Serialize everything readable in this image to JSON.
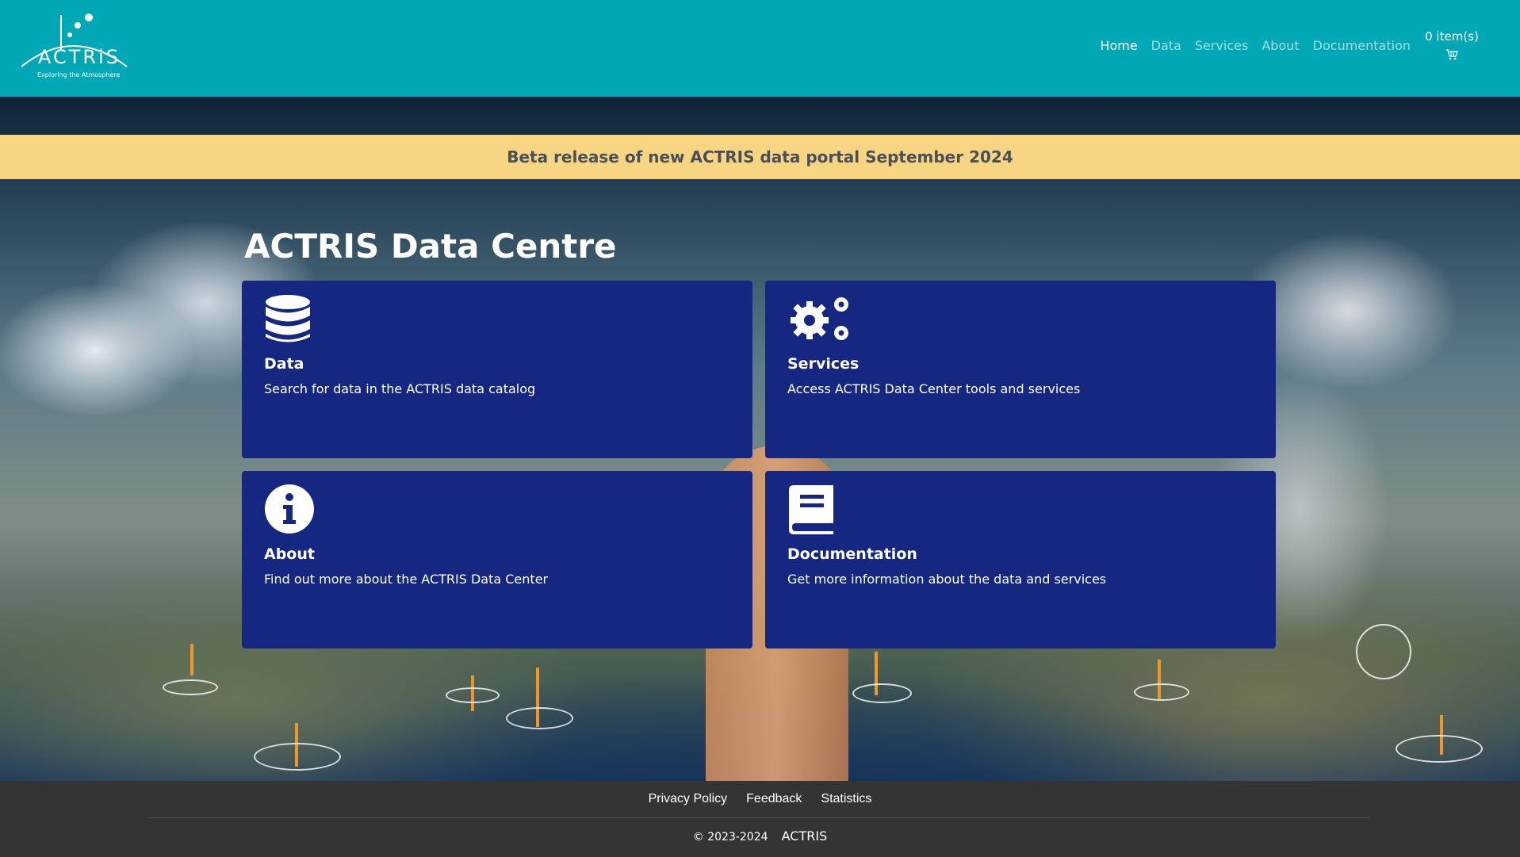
{
  "header": {
    "logo_text": "ACTRiS",
    "logo_tagline": "Exploring the Atmosphere",
    "nav": [
      {
        "label": "Home",
        "active": true
      },
      {
        "label": "Data",
        "active": false
      },
      {
        "label": "Services",
        "active": false
      },
      {
        "label": "About",
        "active": false
      },
      {
        "label": "Documentation",
        "active": false
      }
    ],
    "cart_count": "0 item(s)",
    "cart_icon": "cart-icon"
  },
  "banner": {
    "text": "Beta release of new ACTRIS data portal September 2024"
  },
  "hero": {
    "title": "ACTRIS Data Centre"
  },
  "cards": [
    {
      "title": "Data",
      "description": "Search for data in the ACTRIS data catalog",
      "icon": "database-icon"
    },
    {
      "title": "Services",
      "description": "Access ACTRIS Data Center tools and services",
      "icon": "gears-icon"
    },
    {
      "title": "About",
      "description": "Find out more about the ACTRIS Data Center",
      "icon": "info-icon"
    },
    {
      "title": "Documentation",
      "description": "Get more information about the data and services",
      "icon": "book-icon"
    }
  ],
  "footer": {
    "links": [
      "Privacy Policy",
      "Feedback",
      "Statistics"
    ],
    "copyright": "© 2023-2024",
    "org": "ACTRIS"
  },
  "colors": {
    "header_bg": "#00a8b5",
    "banner_bg": "#f7d583",
    "card_bg": "#152780",
    "footer_bg": "#343434"
  }
}
